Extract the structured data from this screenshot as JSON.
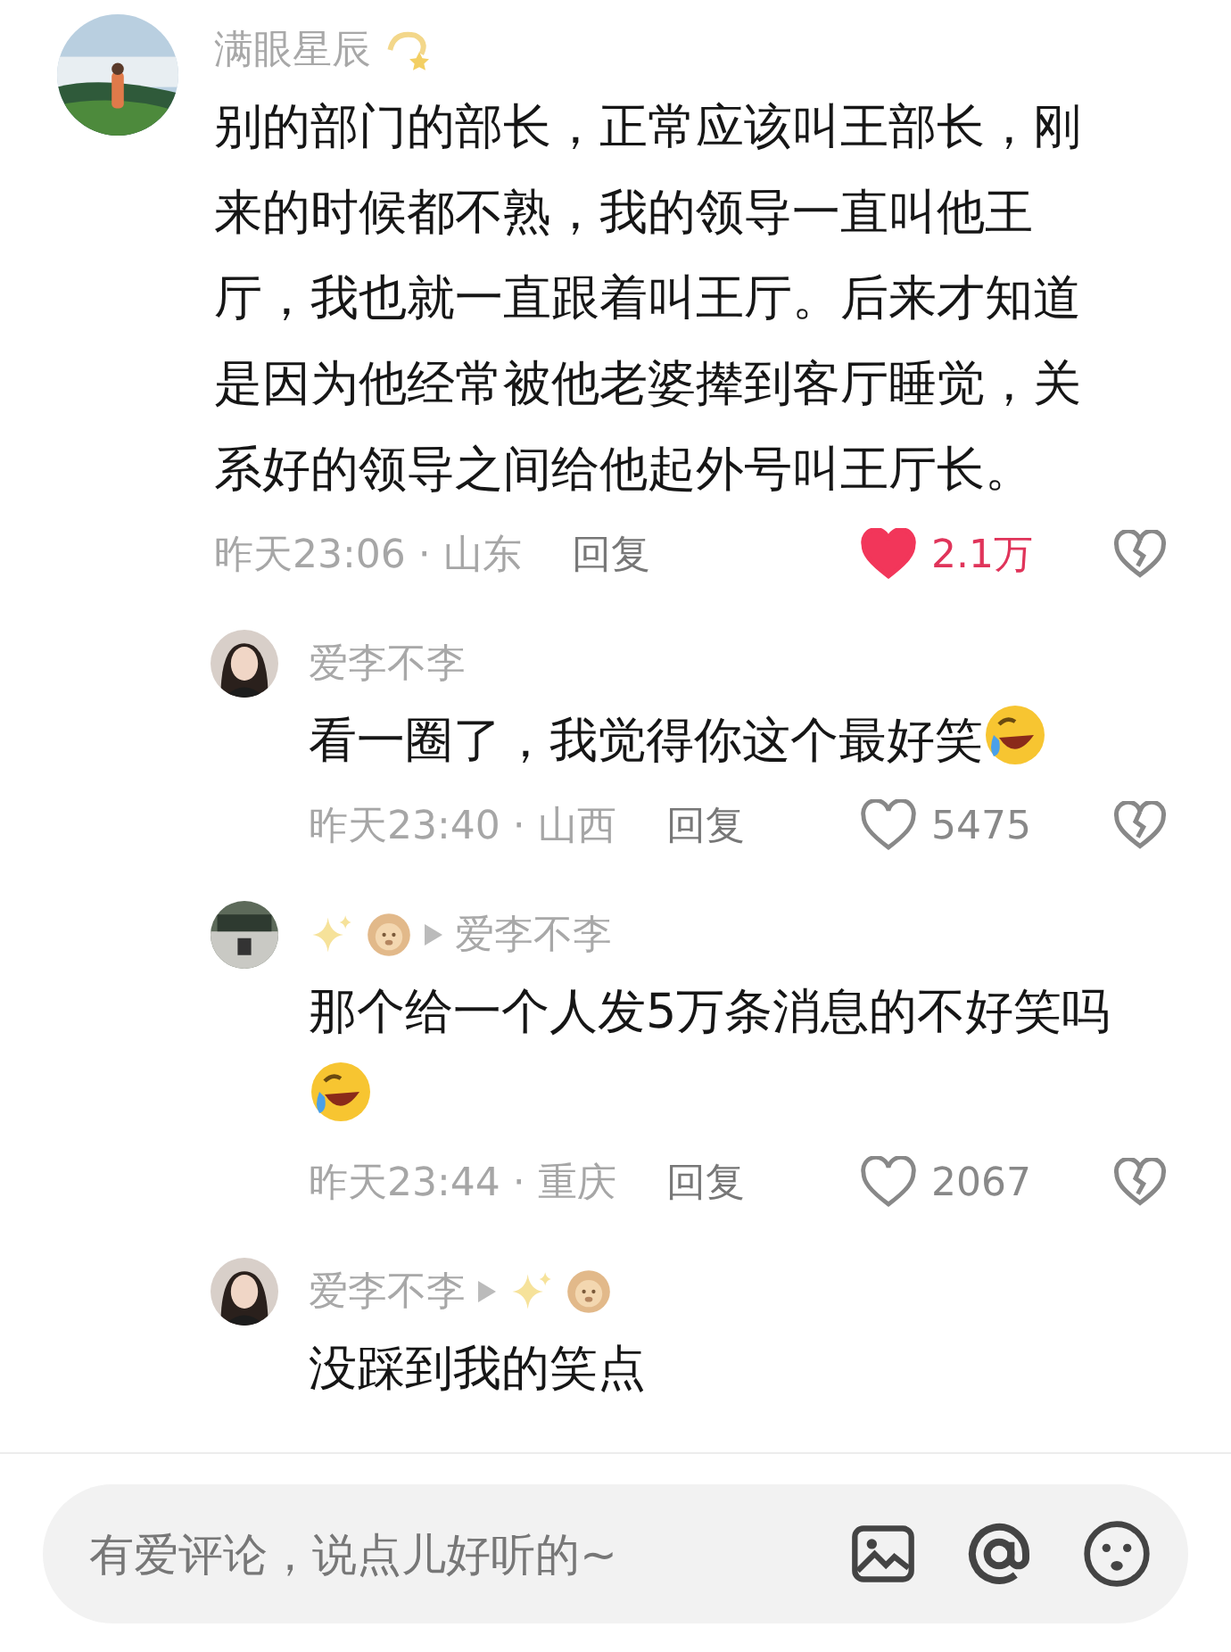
{
  "comments": [
    {
      "kind": "top",
      "avatar": {
        "kind": "picture"
      },
      "name_parts": [
        {
          "kind": "text",
          "text": "满眼星辰"
        },
        {
          "kind": "dizzy"
        }
      ],
      "text": "别的部门的部长，正常应该叫王部长，刚来的时候都不熟，我的领导一直叫他王厅，我也就一直跟着叫王厅。后来才知道是因为他经常被他老婆撵到客厅睡觉，关系好的领导之间给他起外号叫王厅长。",
      "time": "昨天23:06 · 山东",
      "reply_label": "回复",
      "likes": "2.1万",
      "liked": true
    },
    {
      "kind": "reply",
      "avatar": {
        "kind": "picture"
      },
      "name_parts": [
        {
          "kind": "text",
          "text": "爱李不李"
        }
      ],
      "text": "看一圈了，我觉得你这个最好笑",
      "emoji": {
        "kind": "rofl"
      },
      "time": "昨天23:40 · 山西",
      "reply_label": "回复",
      "likes": "5475",
      "liked": false
    },
    {
      "kind": "reply",
      "avatar": {
        "kind": "picture"
      },
      "name_parts": [
        {
          "kind": "sparkles"
        },
        {
          "kind": "lion"
        },
        {
          "kind": "arrow"
        },
        {
          "kind": "text",
          "text": "爱李不李"
        }
      ],
      "text": "那个给一个人发5万条消息的不好笑吗",
      "emoji": {
        "kind": "rofl"
      },
      "time": "昨天23:44 · 重庆",
      "reply_label": "回复",
      "likes": "2067",
      "liked": false
    },
    {
      "kind": "reply",
      "avatar": {
        "kind": "picture"
      },
      "name_parts": [
        {
          "kind": "text",
          "text": "爱李不李"
        },
        {
          "kind": "arrow"
        },
        {
          "kind": "sparkles"
        },
        {
          "kind": "lion"
        }
      ],
      "text": "没踩到我的笑点"
    }
  ],
  "composer": {
    "placeholder": "有爱评论，说点儿好听的~"
  }
}
